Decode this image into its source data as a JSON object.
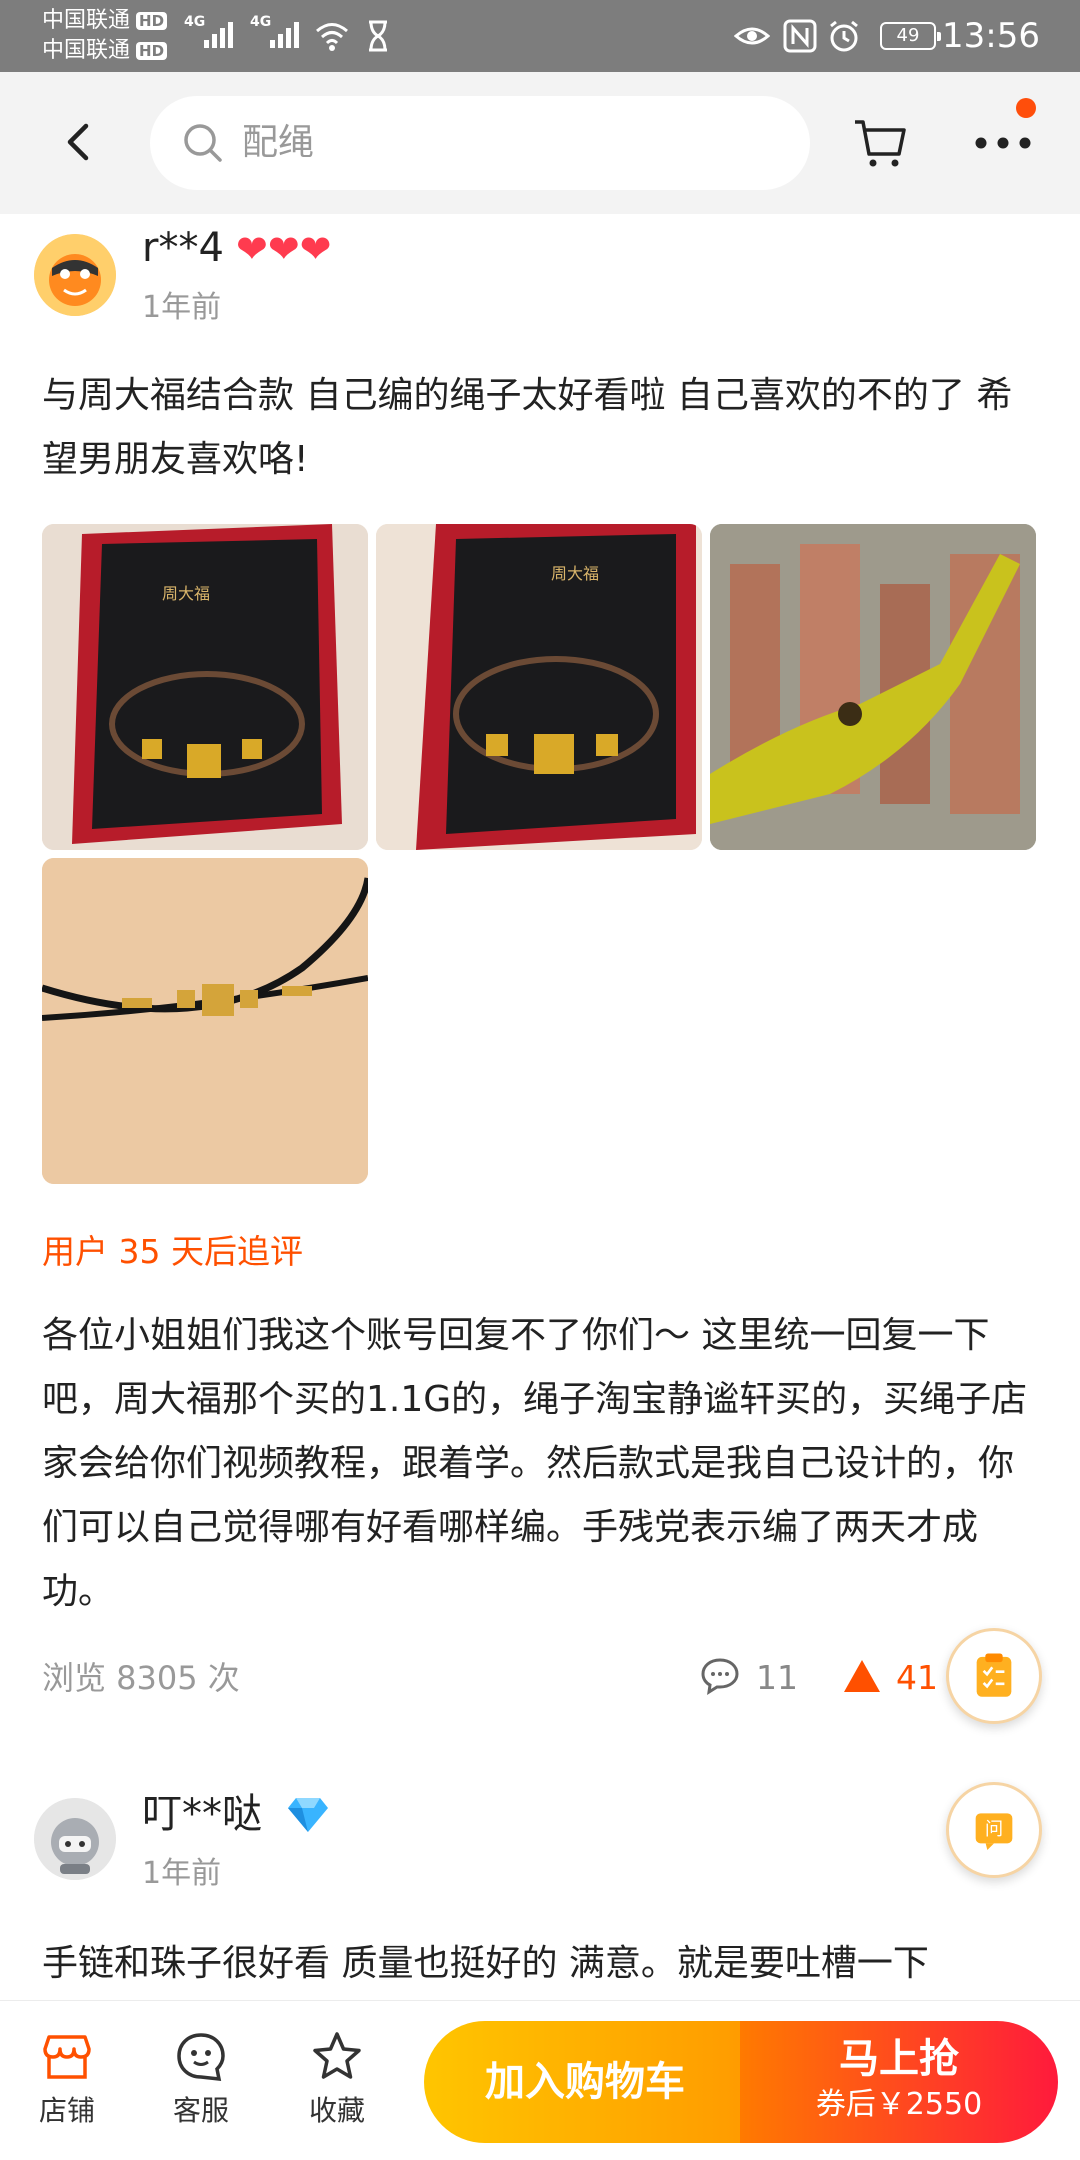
{
  "status_bar": {
    "carrier1": "中国联通",
    "carrier2": "中国联通",
    "hd": "HD",
    "network": "4G",
    "battery": "49",
    "time": "13:56"
  },
  "nav": {
    "search_placeholder": "配绳"
  },
  "review1": {
    "username": "r**4",
    "hearts": "❤❤❤",
    "time": "1年前",
    "text": "与周大福结合款 自己编的绳子太好看啦 自己喜欢的不的了 希望男朋友喜欢咯!",
    "followup_label": "用户 35 天后追评",
    "followup_text": "各位小姐姐们我这个账号回复不了你们～ 这里统一回复一下吧，周大福那个买的1.1G的，绳子淘宝静谧轩买的，买绳子店家会给你们视频教程，跟着学。然后款式是我自己设计的，你们可以自己觉得哪有好看哪样编。手残党表示编了两天才成功。",
    "views": "浏览 8305 次",
    "comments": "11",
    "likes": "41",
    "box_brand": "周大福"
  },
  "review2": {
    "username": "叮**哒",
    "time": "1年前",
    "text": "手链和珠子很好看 质量也挺好的 满意。就是要吐槽一下"
  },
  "float": {
    "ask_label": "问"
  },
  "bottom": {
    "shop_label": "店铺",
    "service_label": "客服",
    "fav_label": "收藏",
    "add_cart_label": "加入购物车",
    "buy_label": "马上抢",
    "price_label": "券后￥2550"
  },
  "colors": {
    "accent": "#ff5000",
    "status_bar": "#7d7d7d",
    "cart_button": "#ffb400",
    "buy_button": "#ff2a3a"
  }
}
